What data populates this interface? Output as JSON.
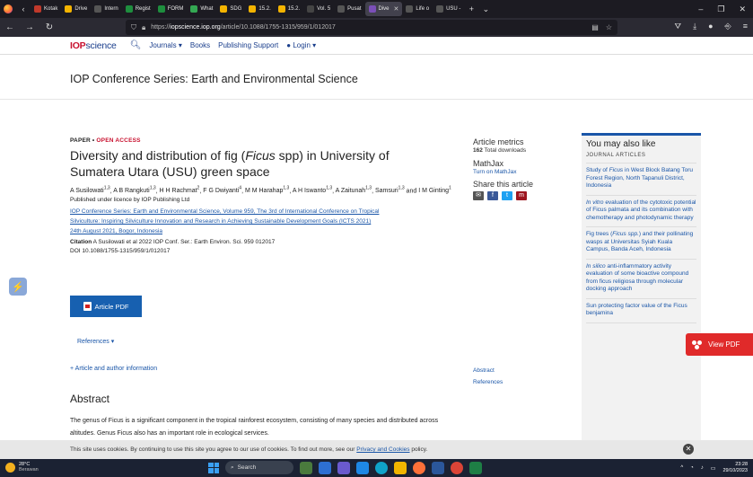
{
  "browser": {
    "tabs": [
      {
        "label": "Kotak",
        "color": "#c0392b"
      },
      {
        "label": "Drive",
        "color": "#f4b400"
      },
      {
        "label": "Intern",
        "color": "#555555"
      },
      {
        "label": "Regist",
        "color": "#1e8e3e"
      },
      {
        "label": "FORM",
        "color": "#1e8e3e"
      },
      {
        "label": "What",
        "color": "#34a853"
      },
      {
        "label": "SDG",
        "color": "#f4b400"
      },
      {
        "label": "15.2.",
        "color": "#f4b400"
      },
      {
        "label": "15.2.",
        "color": "#f4b400"
      },
      {
        "label": "Vol. 5",
        "color": "#444444"
      },
      {
        "label": "Pusat",
        "color": "#555555"
      },
      {
        "label": "Dive",
        "color": "#7b4fb8",
        "active": true
      },
      {
        "label": "Life o",
        "color": "#555555"
      },
      {
        "label": "USU -",
        "color": "#555555"
      }
    ],
    "url_prefix": "https://",
    "url_domain": "iopscience.iop.org",
    "url_path": "/article/10.1088/1755-1315/959/1/012017"
  },
  "site": {
    "logo_iop": "IOP",
    "logo_science": "science",
    "nav": [
      "Journals ▾",
      "Books",
      "Publishing Support",
      "Login ▾"
    ]
  },
  "journal_title": "IOP Conference Series: Earth and Environmental Science",
  "article": {
    "kicker_type": "PAPER • ",
    "kicker_access": "OPEN ACCESS",
    "title_part1": "Diversity and distribution of fig (",
    "title_italic": "Ficus",
    "title_part2": " spp) in University of Sumatera Utara (USU) green space",
    "authors": [
      {
        "name": "A Susilowati",
        "sup": "1,3"
      },
      {
        "name": "A B Rangkuti",
        "sup": "1,3"
      },
      {
        "name": "H H Rachmat",
        "sup": "2"
      },
      {
        "name": "F G Dwiyanti",
        "sup": "4"
      },
      {
        "name": "M M Harahap",
        "sup": "1,3"
      },
      {
        "name": "A H Iswanto",
        "sup": "1,3"
      },
      {
        "name": "A Zaitunah",
        "sup": "1,3"
      },
      {
        "name": "Samsuri",
        "sup": "1,3"
      },
      {
        "name": "I M Ginting",
        "sup": "1"
      }
    ],
    "licence": "Published under licence by IOP Publishing Ltd",
    "source_line1": "IOP Conference Series: Earth and Environmental Science, Volume 959, The 3rd of International Conference on Tropical",
    "source_line2": "Silviculture: Inspiring Silviculture Innovation and Research in Achieving Sustainable Development Goals (ICTS 2021)",
    "source_line3": "24th August 2021, Bogor, Indonesia",
    "citation_label": "Citation",
    "citation_text": " A Susilowati et al 2022 IOP Conf. Ser.: Earth Environ. Sci. 959 012017",
    "doi": "DOI 10.1088/1755-1315/959/1/012017",
    "pdf_button": "Article PDF",
    "references": "References ▾",
    "article_info": "+ Article and author information",
    "abstract_heading": "Abstract",
    "abstract_text": "The genus of Ficus is a significant component in the tropical rainforest ecosystem, consisting of many species and distributed across altitudes. Genus Ficus also has an important role in ecological services."
  },
  "metrics": {
    "heading": "Article metrics",
    "downloads_count": "162",
    "downloads_label": " Total downloads",
    "mathjax_heading": "MathJax",
    "mathjax_link": "Turn on MathJax",
    "share_heading": "Share this article",
    "share_icons": [
      "email-icon",
      "facebook-icon",
      "twitter-icon",
      "mendeley-icon"
    ],
    "abstract_link": "Abstract",
    "references_link": "References"
  },
  "sidebar": {
    "heading": "You may also like",
    "subheading": "JOURNAL ARTICLES",
    "items": [
      {
        "pre": "Study of ",
        "it": "Ficus",
        "post": " in West Block Batang Toru Forest Region, North Tapanuli District, Indonesia"
      },
      {
        "pre": "",
        "it": "In vitro",
        "post": " evaluation of the cytotoxic potential of Ficus palmata and its combination with chemotherapy and photodynamic therapy"
      },
      {
        "pre": "Fig trees (",
        "it": "Ficus spp.",
        "post": ") and their pollinating wasps at Universitas Syiah Kuala Campus, Banda Aceh, Indonesia"
      },
      {
        "pre": "",
        "it": "In silico",
        "post": " anti-inflammatory activity evaluation of some bioactive compound from ficus religiosa through molecular docking approach"
      },
      {
        "pre": "Sun protecting factor value of the Ficus benjamina",
        "it": "",
        "post": ""
      }
    ]
  },
  "view_pdf": "View PDF",
  "cookie": {
    "text": "This site uses cookies. By continuing to use this site you agree to our use of cookies. To find out more, see our ",
    "link": "Privacy and Cookies",
    "end": " policy.",
    "close": "✕"
  },
  "taskbar": {
    "temp": "28°C",
    "weather": "Berawan",
    "search": "Search",
    "time": "23:28",
    "date": "29/10/2023"
  }
}
